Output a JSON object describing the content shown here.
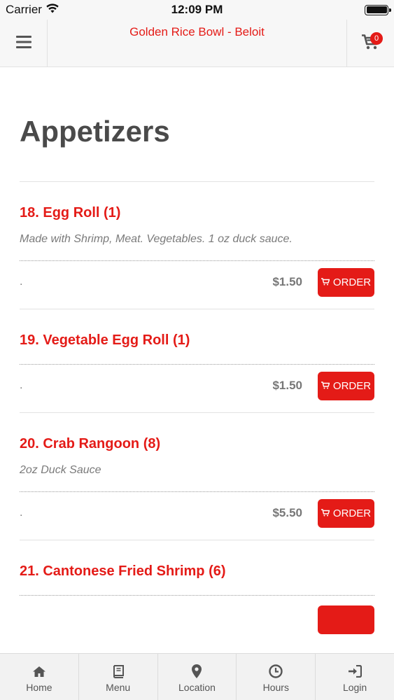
{
  "status_bar": {
    "carrier": "Carrier",
    "time": "12:09 PM"
  },
  "header": {
    "title": "Golden Rice Bowl - Beloit",
    "cart_count": "0",
    "accent_color": "#e41b17"
  },
  "section": {
    "title": "Appetizers"
  },
  "items": [
    {
      "name": "18. Egg Roll (1)",
      "description": "Made with Shrimp, Meat. Vegetables. 1 oz duck sauce.",
      "dot": ".",
      "price": "$1.50",
      "order_label": "ORDER"
    },
    {
      "name": "19. Vegetable Egg Roll (1)",
      "description": "",
      "dot": ".",
      "price": "$1.50",
      "order_label": "ORDER"
    },
    {
      "name": "20. Crab Rangoon (8)",
      "description": "2oz Duck Sauce",
      "dot": ".",
      "price": "$5.50",
      "order_label": "ORDER"
    },
    {
      "name": "21. Cantonese Fried Shrimp (6)",
      "description": "",
      "dot": "",
      "price": "",
      "order_label": ""
    }
  ],
  "tabs": [
    {
      "label": "Home",
      "icon": "home-icon"
    },
    {
      "label": "Menu",
      "icon": "book-icon"
    },
    {
      "label": "Location",
      "icon": "map-pin-icon"
    },
    {
      "label": "Hours",
      "icon": "clock-icon"
    },
    {
      "label": "Login",
      "icon": "login-icon"
    }
  ]
}
